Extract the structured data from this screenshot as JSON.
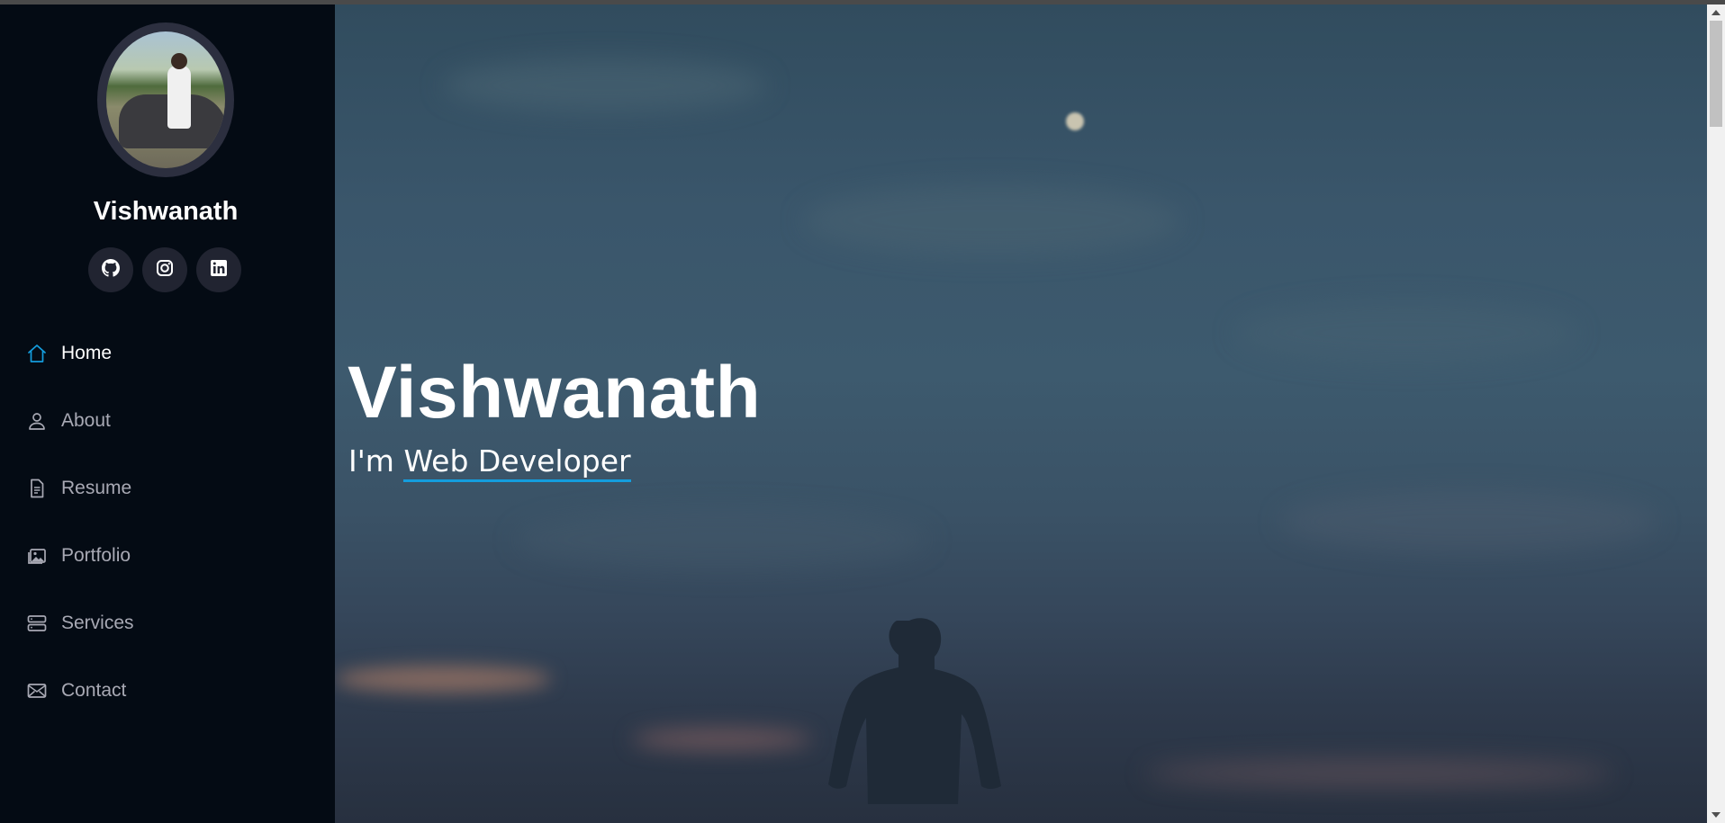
{
  "sidebar": {
    "name": "Vishwanath",
    "avatar_alt": "profile photo",
    "socials": [
      {
        "icon": "github-icon"
      },
      {
        "icon": "instagram-icon"
      },
      {
        "icon": "linkedin-icon"
      }
    ],
    "nav": [
      {
        "label": "Home",
        "icon": "home-icon",
        "active": true
      },
      {
        "label": "About",
        "icon": "person-icon",
        "active": false
      },
      {
        "label": "Resume",
        "icon": "file-icon",
        "active": false
      },
      {
        "label": "Portfolio",
        "icon": "images-icon",
        "active": false
      },
      {
        "label": "Services",
        "icon": "server-icon",
        "active": false
      },
      {
        "label": "Contact",
        "icon": "envelope-icon",
        "active": false
      }
    ]
  },
  "hero": {
    "title": "Vishwanath",
    "prefix": "I'm",
    "typed": "Web Developer"
  },
  "colors": {
    "sidebar_bg": "#040b14",
    "accent": "#149ddd",
    "social_bg": "#212431",
    "nav_text": "#a8a9b4"
  }
}
